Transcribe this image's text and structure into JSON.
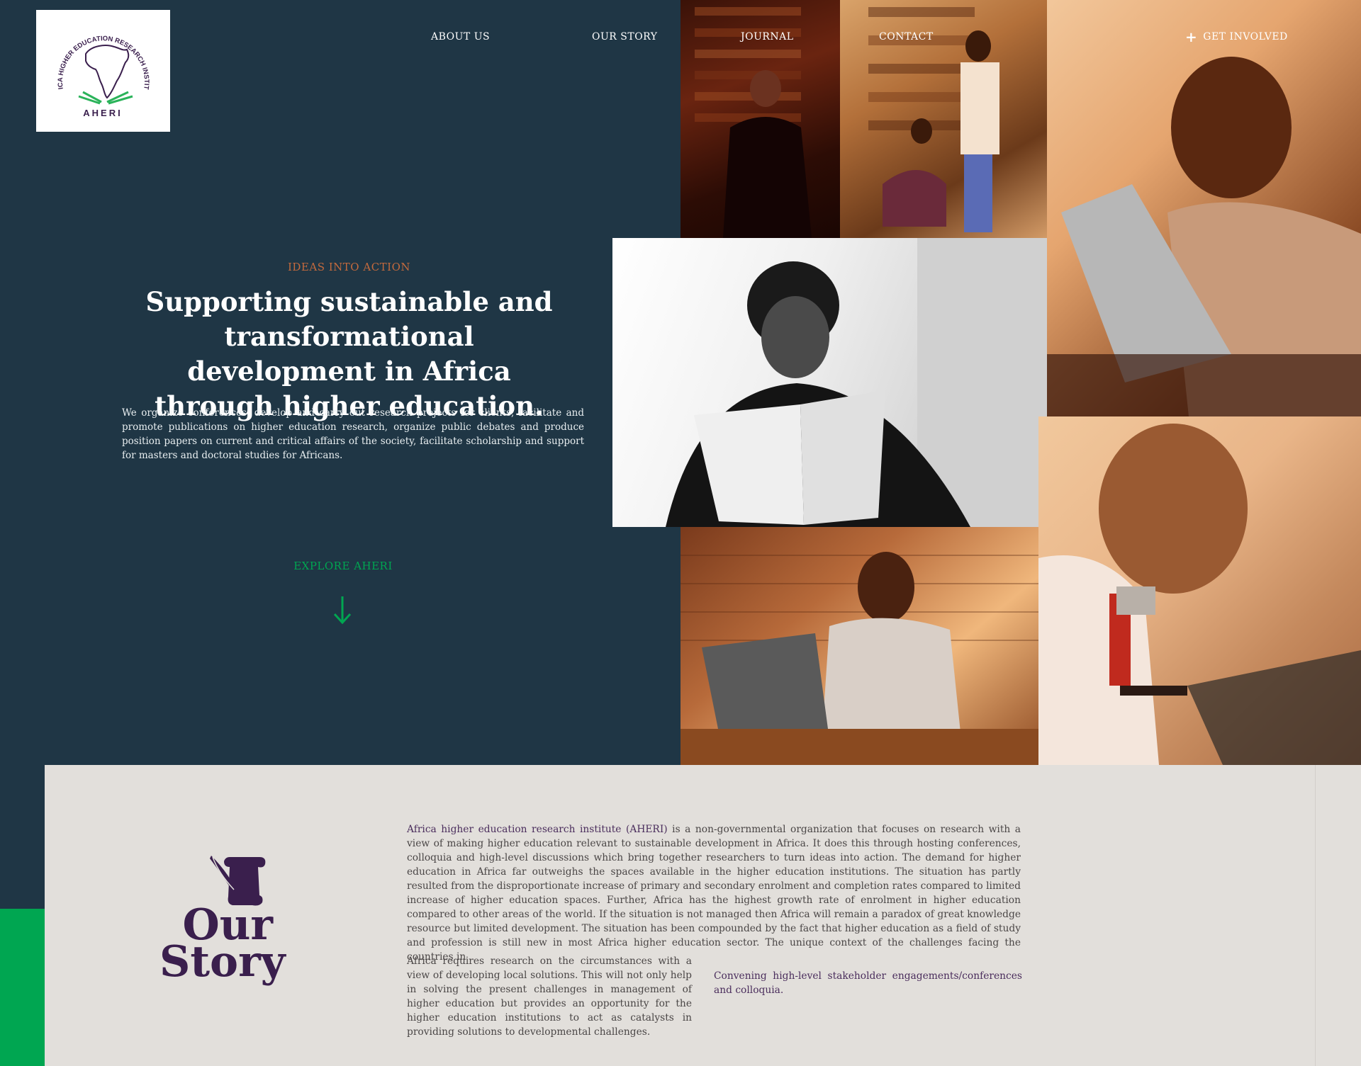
{
  "logo": {
    "arc_text": "AFRICA HIGHER EDUCATION RESEARCH INSTITUTE",
    "wordmark": "AHERI"
  },
  "nav": {
    "about": "ABOUT US",
    "story": "OUR STORY",
    "journal": "JOURNAL",
    "contact": "CONTACT",
    "get_involved": "GET INVOLVED",
    "get_involved_icon": "plus-icon"
  },
  "hero": {
    "kicker": "IDEAS INTO ACTION",
    "headline": "Supporting sustainable and transformational development in Africa through higher education.",
    "intro": "We organize conferences, develop and carry out research projects for clients, facilitate and promote publications on higher education research, organize public debates and produce position papers on current and critical affairs of the society, facilitate scholarship and support for masters and doctoral studies for Africans.",
    "explore": "EXPLORE AHERI",
    "explore_icon": "arrow-down-icon"
  },
  "colors": {
    "navy": "#1f3645",
    "accent_orange": "#c46a3d",
    "accent_green": "#00a651",
    "purple": "#3a1f4d",
    "panel": "#e2dfdb"
  },
  "story": {
    "title_line1": "Our",
    "title_line2": "Story",
    "icon": "scroll-quill-icon",
    "lead": "Africa higher education research institute (AHERI)",
    "body": " is a non-governmental organization that focuses on research with a view of making higher education relevant to sustainable development in Africa. It does this through hosting conferences, colloquia and high-level discussions which bring together researchers to turn ideas into action.  The demand for higher education in Africa far outweighs the spaces available in the higher education institutions. The situation has partly resulted from the disproportionate increase of primary and secondary enrolment and completion rates compared to limited increase of higher education spaces. Further, Africa has the highest growth rate of enrolment in higher education compared to other areas of the world. If the situation is not managed then Africa will remain a paradox of great knowledge resource but limited development. The situation has been compounded by the fact that higher education as a field of study and profession is still new in most Africa higher education sector. The unique context of the challenges facing the countries in",
    "col_left": "Africa requires research on the circumstances with a view of developing local solutions. This will not only help in solving the present challenges in management of higher education but provides an opportunity for the higher education institutions to act as catalysts in providing solutions to developmental challenges.",
    "col_right": "Convening high-level stakeholder engagements/conferences and colloquia."
  }
}
